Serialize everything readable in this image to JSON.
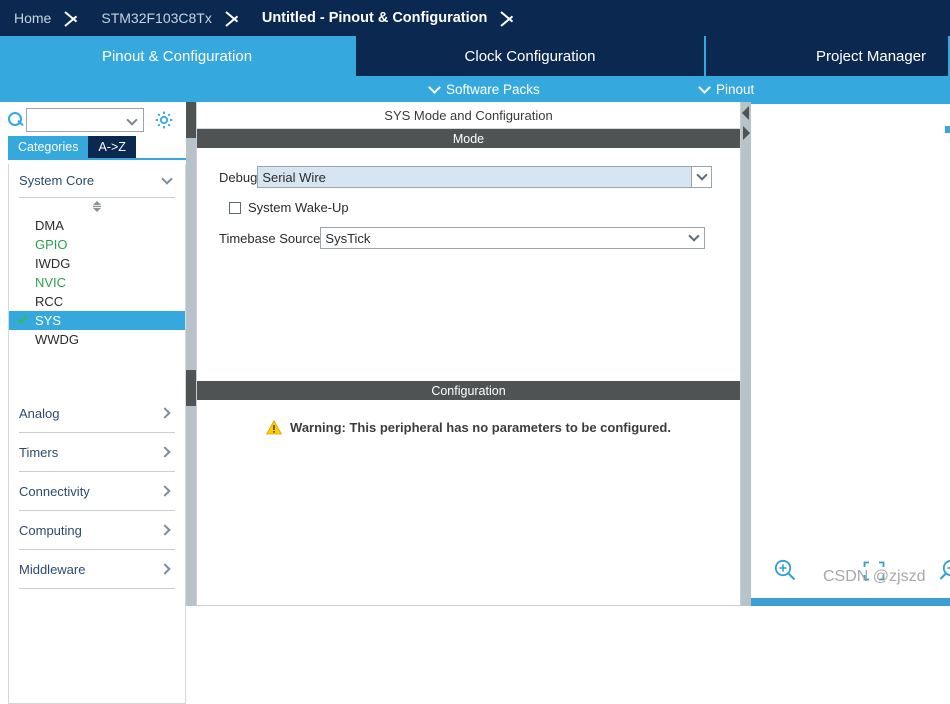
{
  "breadcrumb": {
    "items": [
      {
        "label": "Home",
        "active": false
      },
      {
        "label": "STM32F103C8Tx",
        "active": false
      },
      {
        "label": "Untitled - Pinout & Configuration",
        "active": true
      }
    ]
  },
  "tabs": [
    {
      "label": "Pinout & Configuration",
      "active": true
    },
    {
      "label": "Clock Configuration",
      "active": false
    },
    {
      "label": "Project Manager",
      "active": false
    }
  ],
  "subnav": {
    "software_packs": "Software Packs",
    "pinout": "Pinout"
  },
  "sidebar": {
    "search": {
      "value": "",
      "placeholder": ""
    },
    "mode_tabs": [
      {
        "label": "Categories",
        "active": true
      },
      {
        "label": "A->Z",
        "active": false
      }
    ],
    "groups": [
      {
        "label": "System Core",
        "expanded": true,
        "items": [
          {
            "label": "DMA",
            "state": "default"
          },
          {
            "label": "GPIO",
            "state": "configured"
          },
          {
            "label": "IWDG",
            "state": "default"
          },
          {
            "label": "NVIC",
            "state": "configured"
          },
          {
            "label": "RCC",
            "state": "default"
          },
          {
            "label": "SYS",
            "state": "selected"
          },
          {
            "label": "WWDG",
            "state": "default"
          }
        ]
      },
      {
        "label": "Analog",
        "expanded": false,
        "items": []
      },
      {
        "label": "Timers",
        "expanded": false,
        "items": []
      },
      {
        "label": "Connectivity",
        "expanded": false,
        "items": []
      },
      {
        "label": "Computing",
        "expanded": false,
        "items": []
      },
      {
        "label": "Middleware",
        "expanded": false,
        "items": []
      }
    ]
  },
  "config": {
    "title": "SYS Mode and Configuration",
    "mode_header": "Mode",
    "debug_label": "Debug",
    "debug_value": "Serial Wire",
    "wakeup_label": "System Wake-Up",
    "wakeup_checked": false,
    "timebase_label": "Timebase Source",
    "timebase_value": "SysTick",
    "configuration_header": "Configuration",
    "warning_text": "Warning: This peripheral has no parameters to be configured."
  },
  "chipview": {
    "watermark": "CSDN @zjszd",
    "zoom_in": "zoom-in",
    "zoom_fit": "fit-to-screen",
    "zoom_out": "zoom-out"
  },
  "colors": {
    "navy": "#0b2950",
    "accent_blue": "#35a8dd",
    "section_gray": "#4f5353",
    "configured_green": "#28a34c",
    "modified_field": "#d7e5f3",
    "warning_yellow": "#ffcc00"
  }
}
